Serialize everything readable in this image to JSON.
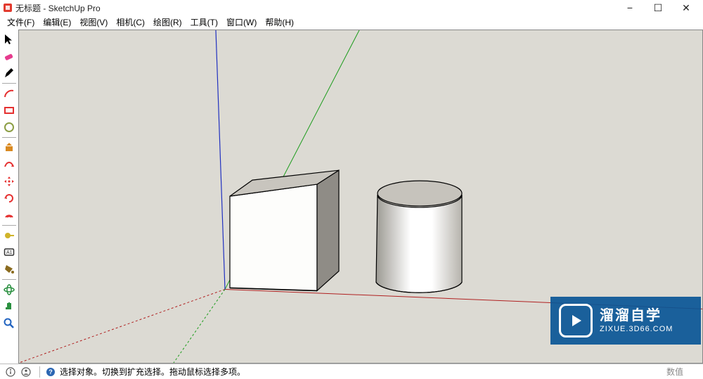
{
  "window": {
    "title": "无标题 - SketchUp Pro",
    "controls": {
      "minimize": "−",
      "maximize": "☐",
      "close": "✕"
    }
  },
  "menu": {
    "items": [
      "文件(F)",
      "编辑(E)",
      "视图(V)",
      "相机(C)",
      "绘图(R)",
      "工具(T)",
      "窗口(W)",
      "帮助(H)"
    ]
  },
  "tools": [
    {
      "name": "select-tool-icon",
      "glyph": "cursor",
      "color": "#000000"
    },
    {
      "name": "eraser-tool-icon",
      "glyph": "eraser",
      "color": "#E63B8E"
    },
    {
      "name": "pencil-tool-icon",
      "glyph": "pencil",
      "color": "#000000"
    },
    {
      "name": "separator"
    },
    {
      "name": "arc-tool-icon",
      "glyph": "arc",
      "color": "#E53030"
    },
    {
      "name": "rectangle-tool-icon",
      "glyph": "rect",
      "color": "#E53030"
    },
    {
      "name": "circle-tool-icon",
      "glyph": "circle",
      "color": "#8C9E45"
    },
    {
      "name": "separator"
    },
    {
      "name": "push-pull-tool-icon",
      "glyph": "pushpull",
      "color": "#D98A22"
    },
    {
      "name": "follow-me-tool-icon",
      "glyph": "followme",
      "color": "#E53030"
    },
    {
      "name": "move-tool-icon",
      "glyph": "move",
      "color": "#E53030"
    },
    {
      "name": "rotate-tool-icon",
      "glyph": "rotate",
      "color": "#E53030"
    },
    {
      "name": "offset-tool-icon",
      "glyph": "offset",
      "color": "#E53030"
    },
    {
      "name": "separator"
    },
    {
      "name": "tape-measure-icon",
      "glyph": "tape",
      "color": "#D0B42A"
    },
    {
      "name": "text-tool-icon",
      "glyph": "text",
      "color": "#333333"
    },
    {
      "name": "paint-bucket-icon",
      "glyph": "paint",
      "color": "#8A6B1F"
    },
    {
      "name": "separator"
    },
    {
      "name": "orbit-tool-icon",
      "glyph": "orbit",
      "color": "#2A9040"
    },
    {
      "name": "pan-tool-icon",
      "glyph": "pan",
      "color": "#2A9040"
    },
    {
      "name": "zoom-tool-icon",
      "glyph": "zoom",
      "color": "#2264C0"
    }
  ],
  "viewport": {
    "background": "#DCDAD3",
    "axes": {
      "x": "#B02020",
      "y": "#1C9C1C",
      "z": "#2030C0"
    },
    "objects": [
      "cube",
      "cylinder"
    ]
  },
  "watermark": {
    "line1": "溜溜自学",
    "line2": "ZIXUE.3D66.COM"
  },
  "statusbar": {
    "message": "选择对象。切换到扩充选择。拖动鼠标选择多项。",
    "right": "数值"
  }
}
